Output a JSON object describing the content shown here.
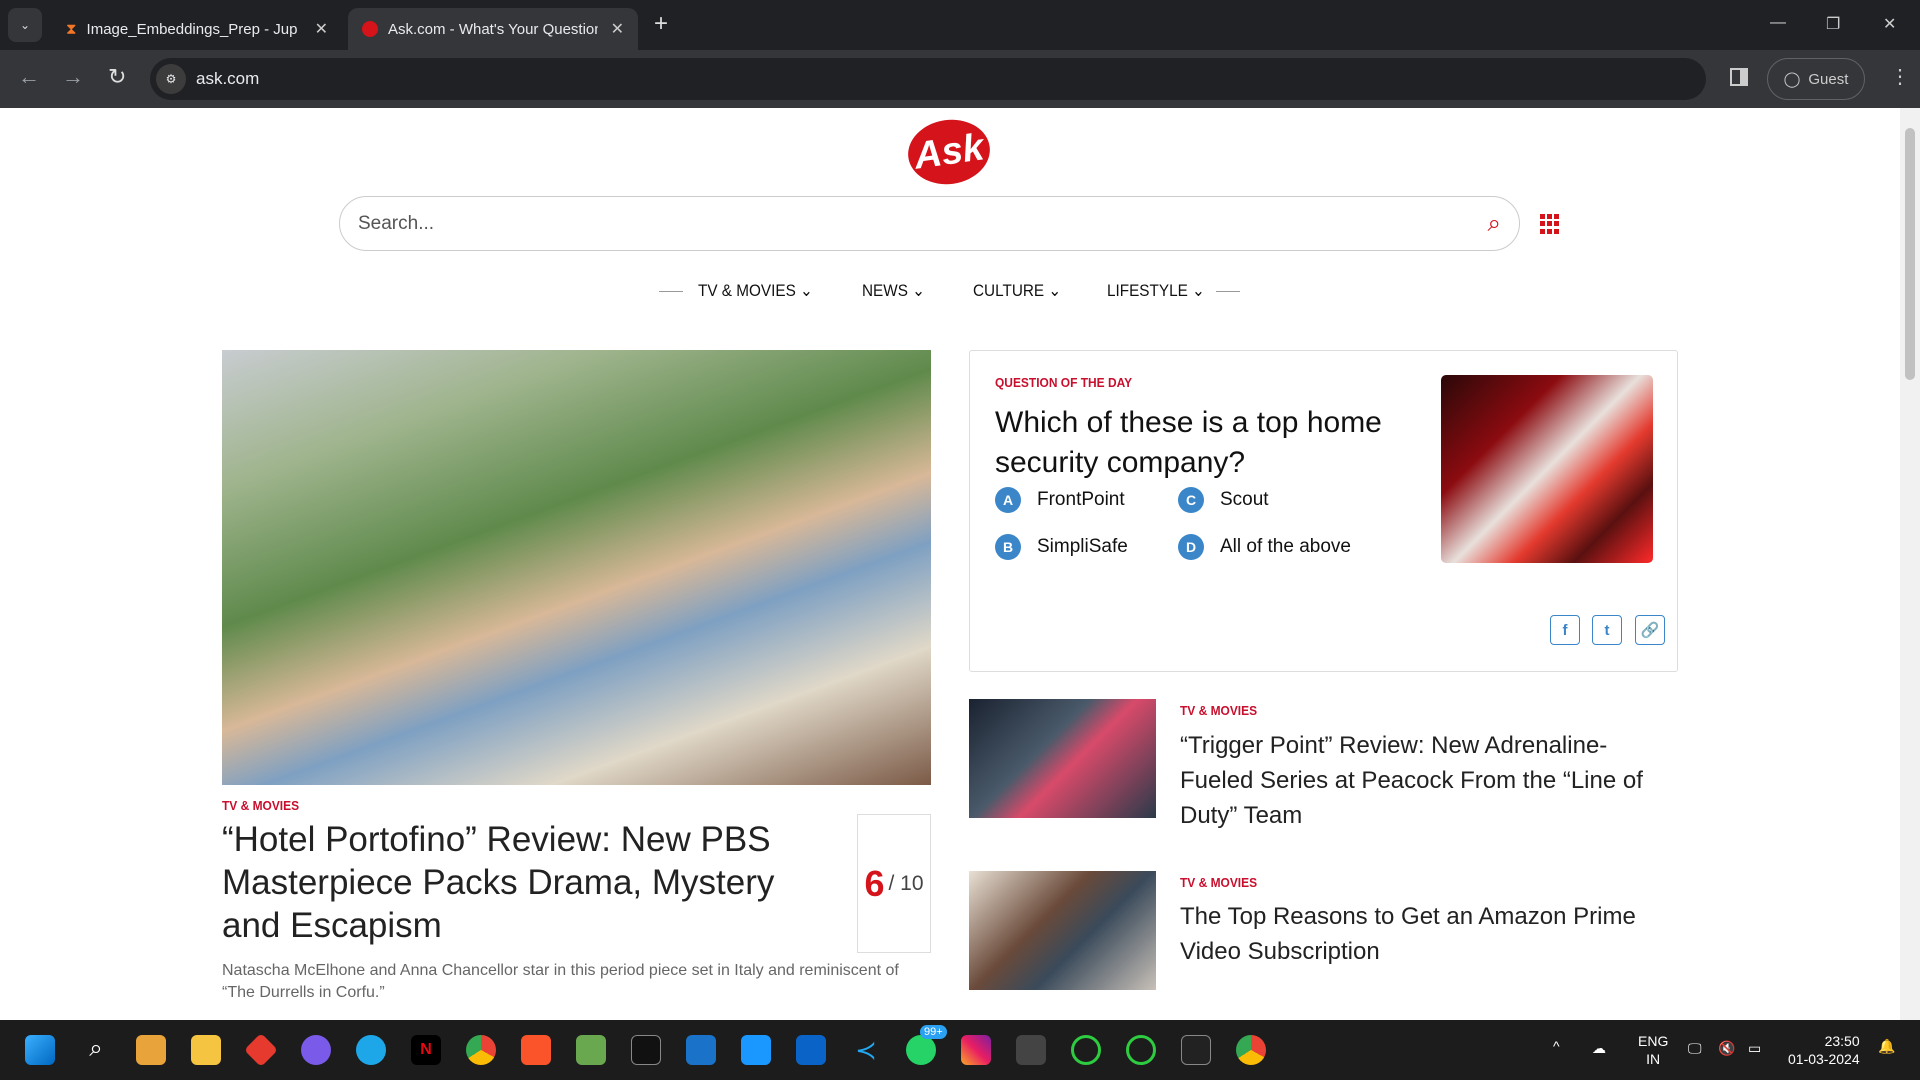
{
  "browser": {
    "tabs": [
      {
        "title": "Image_Embeddings_Prep - Jupyter"
      },
      {
        "title": "Ask.com - What's Your Question?"
      }
    ],
    "url": "ask.com",
    "guest_label": "Guest"
  },
  "page": {
    "logo": "Ask",
    "search_placeholder": "Search...",
    "nav": [
      {
        "label": "TV & MOVIES"
      },
      {
        "label": "NEWS"
      },
      {
        "label": "CULTURE"
      },
      {
        "label": "LIFESTYLE"
      }
    ],
    "hero": {
      "category": "TV & MOVIES",
      "headline": "“Hotel Portofino” Review: New PBS Masterpiece Packs Drama, Mystery and Escapism",
      "score": "6",
      "score_max": "/ 10",
      "description": "Natascha McElhone and Anna Chancellor star in this period piece set in Italy and reminiscent of “The Durrells in Corfu.”"
    },
    "qotd": {
      "label": "QUESTION OF THE DAY",
      "question": "Which of these is a top home security company?",
      "options": [
        {
          "letter": "A",
          "text": "FrontPoint"
        },
        {
          "letter": "B",
          "text": "SimpliSafe"
        },
        {
          "letter": "C",
          "text": "Scout"
        },
        {
          "letter": "D",
          "text": "All of the above"
        }
      ]
    },
    "articles": [
      {
        "category": "TV & MOVIES",
        "headline": "“Trigger Point” Review: New Adrenaline-Fueled Series at Peacock From the “Line of Duty” Team"
      },
      {
        "category": "TV & MOVIES",
        "headline": "The Top Reasons to Get an Amazon Prime Video Subscription"
      }
    ]
  },
  "taskbar": {
    "lang": "ENG",
    "region": "IN",
    "time": "23:50",
    "date": "01-03-2024",
    "whatsapp_badge": "99+"
  },
  "colors": {
    "brand": "#d4131a",
    "option": "#3a86c8"
  }
}
